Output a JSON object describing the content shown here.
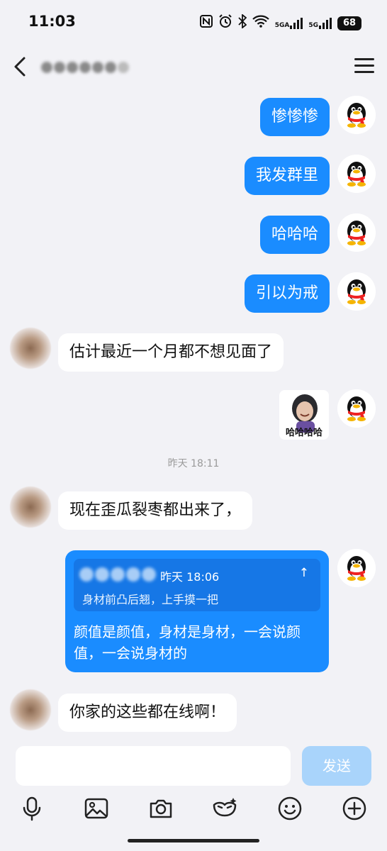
{
  "status_bar": {
    "time": "11:03",
    "signal1_label": "5GA",
    "signal2_label": "5G",
    "battery": "68"
  },
  "header": {
    "back_icon": "chevron-left-icon",
    "menu_icon": "hamburger-menu-icon"
  },
  "messages": [
    {
      "side": "me",
      "text": "惨惨惨"
    },
    {
      "side": "me",
      "text": "我发群里"
    },
    {
      "side": "me",
      "text": "哈哈哈"
    },
    {
      "side": "me",
      "text": "引以为戒"
    },
    {
      "side": "them",
      "text": "估计最近一个月都不想见面了"
    },
    {
      "side": "me",
      "type": "sticker",
      "caption": "哈哈哈哈"
    },
    {
      "side": "them",
      "text": "现在歪瓜裂枣都出来了，"
    },
    {
      "side": "me",
      "type": "quote_reply"
    },
    {
      "side": "them",
      "text": "你家的这些都在线啊！"
    }
  ],
  "timestamp_divider": "昨天 18:11",
  "quote": {
    "time": "昨天 18:06",
    "up_icon": "↑",
    "quoted_text": "身材前凸后翘，上手摸一把",
    "reply_text": "颜值是颜值，身材是身材，一会说颜值，一会说身材的"
  },
  "composer": {
    "input_value": "",
    "send_label": "发送"
  },
  "toolbar": {
    "icons": [
      "microphone-icon",
      "image-icon",
      "camera-icon",
      "mask-icon",
      "emoji-icon",
      "plus-icon"
    ]
  },
  "colors": {
    "accent": "#1a8cff",
    "background": "#f2f2f6",
    "send_disabled": "#a9d4fb"
  }
}
